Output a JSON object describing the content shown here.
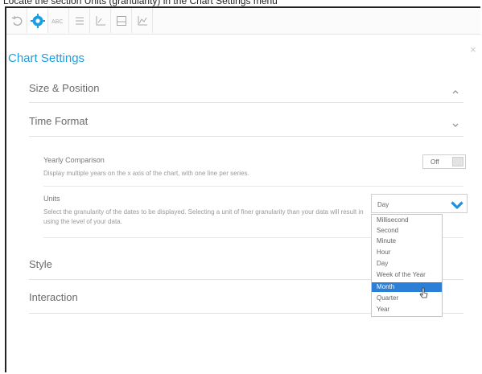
{
  "caption": "Locate the section Units (granularity) in the Chart Settings menu",
  "toolbar": {
    "icons": [
      "undo-icon",
      "gear-icon",
      "text-icon",
      "list-icon",
      "axes-icon",
      "image-icon",
      "chart-icon"
    ]
  },
  "panel": {
    "title": "Chart Settings",
    "close": "×"
  },
  "sections": {
    "size_position": "Size & Position",
    "time_format": "Time Format",
    "style": "Style",
    "interaction": "Interaction"
  },
  "time_format": {
    "yearly_title": "Yearly Comparison",
    "yearly_desc": "Display multiple years on the x axis of the chart, with one line per series.",
    "toggle_label": "Off",
    "units_title": "Units",
    "units_desc": "Select the granularity of the dates to be displayed. Selecting a unit of finer granularity than your data will result in using the level of your data.",
    "units_value": "Day",
    "units_options": [
      "Millisecond",
      "Second",
      "Minute",
      "Hour",
      "Day",
      "Week of the Year",
      "Month",
      "Quarter",
      "Year"
    ],
    "highlighted_option": "Month"
  },
  "colors": {
    "accent": "#1b9fe0",
    "selected": "#2b7fd6"
  }
}
